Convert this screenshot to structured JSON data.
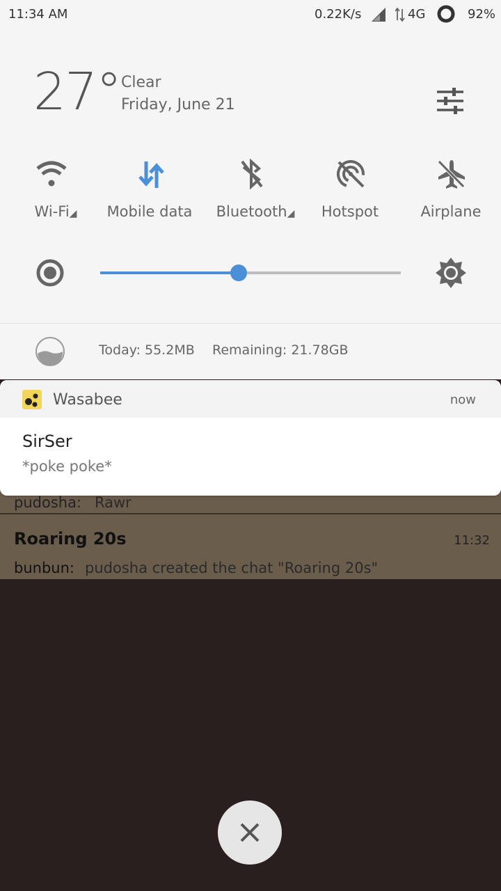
{
  "status_bar": {
    "time": "11:34 AM",
    "speed": "0.22K/s",
    "network": "4G",
    "battery": "92%"
  },
  "weather": {
    "temperature": "27°",
    "condition": "Clear",
    "date": "Friday, June 21"
  },
  "quick_settings": {
    "tiles": [
      {
        "label": "Wi-Fi",
        "icon": "wifi-icon",
        "active": false,
        "has_dropdown": true
      },
      {
        "label": "Mobile data",
        "icon": "mobile-data-icon",
        "active": true,
        "has_dropdown": false
      },
      {
        "label": "Bluetooth",
        "icon": "bluetooth-off-icon",
        "active": false,
        "has_dropdown": true
      },
      {
        "label": "Hotspot",
        "icon": "hotspot-off-icon",
        "active": false,
        "has_dropdown": false
      },
      {
        "label": "Airplane",
        "icon": "airplane-icon",
        "active": false,
        "has_dropdown": false
      }
    ],
    "active_color": "#4a8fd8",
    "inactive_color": "#666666"
  },
  "brightness": {
    "level": 0.46
  },
  "data_usage": {
    "today": "Today: 55.2MB",
    "remaining": "Remaining: 21.78GB"
  },
  "notification": {
    "app_name": "Wasabee",
    "time": "now",
    "title": "SirSer",
    "text": "*poke poke*"
  },
  "chat_list": {
    "partial_sender": "pudosha:",
    "partial_message": "Rawr",
    "chat": {
      "title": "Roaring 20s",
      "time": "11:32",
      "sender": "bunbun:",
      "message": "pudosha created the chat \"Roaring 20s\""
    }
  }
}
